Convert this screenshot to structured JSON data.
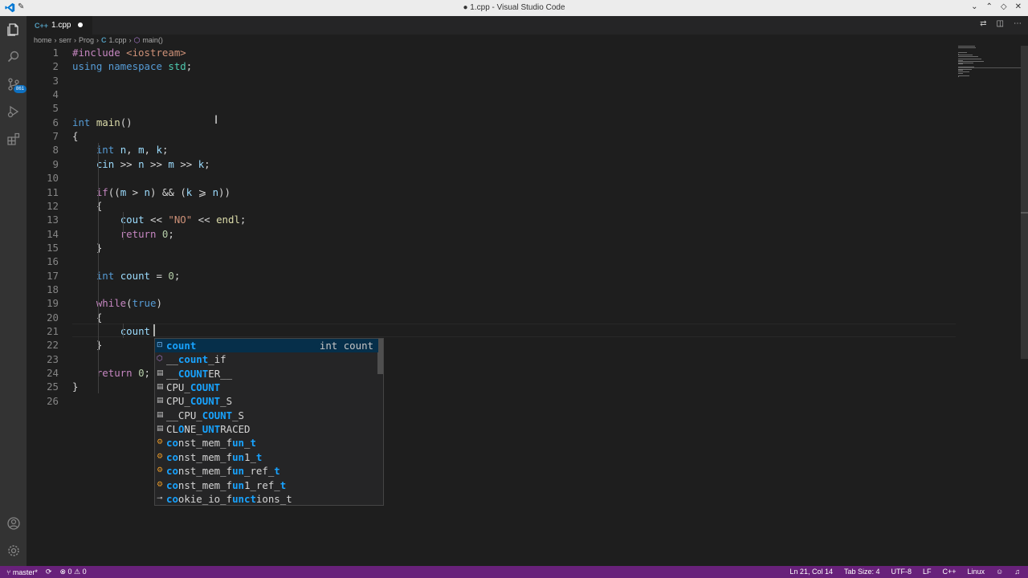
{
  "window": {
    "title": "● 1.cpp - Visual Studio Code"
  },
  "tab": {
    "label": "1.cpp",
    "icon_text": "C++"
  },
  "breadcrumb": [
    "home",
    "serr",
    "Prog",
    "1.cpp",
    "main()"
  ],
  "activity": {
    "scm_badge": "861"
  },
  "line_numbers": [
    "1",
    "2",
    "3",
    "4",
    "5",
    "6",
    "7",
    "8",
    "9",
    "10",
    "11",
    "12",
    "13",
    "14",
    "15",
    "16",
    "17",
    "18",
    "19",
    "20",
    "21",
    "22",
    "23",
    "24",
    "25",
    "26"
  ],
  "code_lines": [
    [
      {
        "t": "#include ",
        "c": "pp"
      },
      {
        "t": "<iostream>",
        "c": "inc"
      }
    ],
    [
      {
        "t": "using ",
        "c": "kw"
      },
      {
        "t": "namespace ",
        "c": "kw"
      },
      {
        "t": "std",
        "c": "ns"
      },
      {
        "t": ";",
        "c": ""
      }
    ],
    [],
    [],
    [],
    [
      {
        "t": "int ",
        "c": "kw"
      },
      {
        "t": "main",
        "c": "fn"
      },
      {
        "t": "()",
        "c": ""
      }
    ],
    [
      {
        "t": "{",
        "c": ""
      }
    ],
    [
      {
        "t": "    ",
        "c": ""
      },
      {
        "t": "int ",
        "c": "kw"
      },
      {
        "t": "n",
        "c": "var"
      },
      {
        "t": ", ",
        "c": ""
      },
      {
        "t": "m",
        "c": "var"
      },
      {
        "t": ", ",
        "c": ""
      },
      {
        "t": "k",
        "c": "var"
      },
      {
        "t": ";",
        "c": ""
      }
    ],
    [
      {
        "t": "    ",
        "c": ""
      },
      {
        "t": "cin",
        "c": "var"
      },
      {
        "t": " >> ",
        "c": ""
      },
      {
        "t": "n",
        "c": "var"
      },
      {
        "t": " >> ",
        "c": ""
      },
      {
        "t": "m",
        "c": "var"
      },
      {
        "t": " >> ",
        "c": ""
      },
      {
        "t": "k",
        "c": "var"
      },
      {
        "t": ";",
        "c": ""
      }
    ],
    [],
    [
      {
        "t": "    ",
        "c": ""
      },
      {
        "t": "if",
        "c": "ctrl"
      },
      {
        "t": "((",
        "c": ""
      },
      {
        "t": "m",
        "c": "var"
      },
      {
        "t": " > ",
        "c": ""
      },
      {
        "t": "n",
        "c": "var"
      },
      {
        "t": ") && (",
        "c": ""
      },
      {
        "t": "k",
        "c": "var"
      },
      {
        "t": " ⩾ ",
        "c": ""
      },
      {
        "t": "n",
        "c": "var"
      },
      {
        "t": "))",
        "c": ""
      }
    ],
    [
      {
        "t": "    {",
        "c": ""
      }
    ],
    [
      {
        "t": "        ",
        "c": ""
      },
      {
        "t": "cout",
        "c": "var"
      },
      {
        "t": " << ",
        "c": ""
      },
      {
        "t": "\"NO\"",
        "c": "str"
      },
      {
        "t": " << ",
        "c": ""
      },
      {
        "t": "endl",
        "c": "fn"
      },
      {
        "t": ";",
        "c": ""
      }
    ],
    [
      {
        "t": "        ",
        "c": ""
      },
      {
        "t": "return ",
        "c": "ctrl"
      },
      {
        "t": "0",
        "c": "num"
      },
      {
        "t": ";",
        "c": ""
      }
    ],
    [
      {
        "t": "    }",
        "c": ""
      }
    ],
    [],
    [
      {
        "t": "    ",
        "c": ""
      },
      {
        "t": "int ",
        "c": "kw"
      },
      {
        "t": "count",
        "c": "var"
      },
      {
        "t": " = ",
        "c": ""
      },
      {
        "t": "0",
        "c": "num"
      },
      {
        "t": ";",
        "c": ""
      }
    ],
    [],
    [
      {
        "t": "    ",
        "c": ""
      },
      {
        "t": "while",
        "c": "ctrl"
      },
      {
        "t": "(",
        "c": ""
      },
      {
        "t": "true",
        "c": "kw"
      },
      {
        "t": ")",
        "c": ""
      }
    ],
    [
      {
        "t": "    {",
        "c": ""
      }
    ],
    [
      {
        "t": "        ",
        "c": ""
      },
      {
        "t": "count",
        "c": "var"
      }
    ],
    [
      {
        "t": "    }",
        "c": ""
      }
    ],
    [],
    [
      {
        "t": "    ",
        "c": ""
      },
      {
        "t": "return ",
        "c": "ctrl"
      },
      {
        "t": "0",
        "c": "num"
      },
      {
        "t": ";",
        "c": ""
      }
    ],
    [
      {
        "t": "}",
        "c": ""
      }
    ],
    []
  ],
  "suggest": [
    {
      "icon": "field",
      "segments": [
        {
          "t": "count",
          "h": true
        }
      ],
      "detail": "int count",
      "selected": true
    },
    {
      "icon": "cube",
      "segments": [
        {
          "t": "__",
          "h": false
        },
        {
          "t": "count",
          "h": true
        },
        {
          "t": "_if",
          "h": false
        }
      ]
    },
    {
      "icon": "const",
      "segments": [
        {
          "t": "__",
          "h": false
        },
        {
          "t": "COUNT",
          "h": true
        },
        {
          "t": "ER__",
          "h": false
        }
      ]
    },
    {
      "icon": "const",
      "segments": [
        {
          "t": "CPU_",
          "h": false
        },
        {
          "t": "COUNT",
          "h": true
        }
      ]
    },
    {
      "icon": "const",
      "segments": [
        {
          "t": "CPU_",
          "h": false
        },
        {
          "t": "COUNT",
          "h": true
        },
        {
          "t": "_S",
          "h": false
        }
      ]
    },
    {
      "icon": "const",
      "segments": [
        {
          "t": "__CPU_",
          "h": false
        },
        {
          "t": "COUNT",
          "h": true
        },
        {
          "t": "_S",
          "h": false
        }
      ]
    },
    {
      "icon": "const",
      "segments": [
        {
          "t": "C",
          "h": false
        },
        {
          "t": "L",
          "h": false
        },
        {
          "t": "O",
          "h": true
        },
        {
          "t": "NE_",
          "h": false
        },
        {
          "t": "UNT",
          "h": true
        },
        {
          "t": "RACED",
          "h": false
        }
      ]
    },
    {
      "icon": "class",
      "segments": [
        {
          "t": "co",
          "h": true
        },
        {
          "t": "nst_mem_f",
          "h": false
        },
        {
          "t": "un",
          "h": true
        },
        {
          "t": "_",
          "h": false
        },
        {
          "t": "t",
          "h": true
        }
      ]
    },
    {
      "icon": "class",
      "segments": [
        {
          "t": "co",
          "h": true
        },
        {
          "t": "nst_mem_f",
          "h": false
        },
        {
          "t": "un",
          "h": true
        },
        {
          "t": "1_",
          "h": false
        },
        {
          "t": "t",
          "h": true
        }
      ]
    },
    {
      "icon": "class",
      "segments": [
        {
          "t": "co",
          "h": true
        },
        {
          "t": "nst_mem_f",
          "h": false
        },
        {
          "t": "un",
          "h": true
        },
        {
          "t": "_ref_",
          "h": false
        },
        {
          "t": "t",
          "h": true
        }
      ]
    },
    {
      "icon": "class",
      "segments": [
        {
          "t": "co",
          "h": true
        },
        {
          "t": "nst_mem_f",
          "h": false
        },
        {
          "t": "un",
          "h": true
        },
        {
          "t": "1_ref_",
          "h": false
        },
        {
          "t": "t",
          "h": true
        }
      ]
    },
    {
      "icon": "iface",
      "segments": [
        {
          "t": "co",
          "h": true
        },
        {
          "t": "okie_io_f",
          "h": false
        },
        {
          "t": "unct",
          "h": true
        },
        {
          "t": "ions_t",
          "h": false
        }
      ]
    }
  ],
  "status": {
    "branch": "master*",
    "problems": "0",
    "warnings": "0",
    "position": "Ln 21, Col 14",
    "tab_size": "Tab Size: 4",
    "encoding": "UTF-8",
    "eol": "LF",
    "language": "C++",
    "platform": "Linux"
  },
  "colors": {
    "status_bar": "#68217a",
    "editor_bg": "#1e1e1e",
    "highlight": "#18a3ff"
  }
}
